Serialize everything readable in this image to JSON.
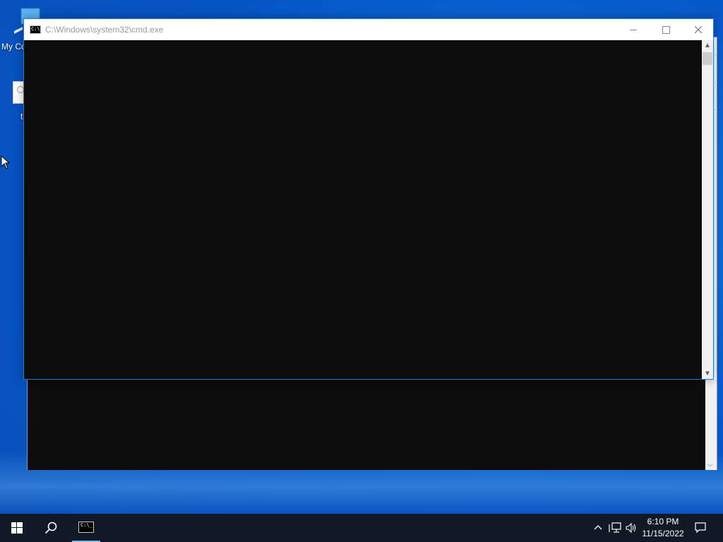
{
  "desktop": {
    "icons": [
      {
        "label": "My Co",
        "icon": "computer-icon"
      },
      {
        "label": "t",
        "icon": "file-icon"
      }
    ]
  },
  "window": {
    "title": "C:\\Windows\\system32\\cmd.exe",
    "icon": "cmd-icon",
    "icon_text": "C:\\_",
    "console_background": "#0c0c0c",
    "border_color": "#2b78d6"
  },
  "taskbar": {
    "background": "#101a26",
    "active_indicator_color": "#76b9ed",
    "items": [
      "start-icon",
      "search-icon",
      "cmd-icon"
    ],
    "tray_icons": [
      "chevron-up-icon",
      "network-icon",
      "volume-icon"
    ],
    "clock": {
      "time": "6:10 PM",
      "date": "11/15/2022"
    },
    "action_center_icon": "notification-icon"
  },
  "colors": {
    "desktop_blue": "#0a66d6"
  }
}
